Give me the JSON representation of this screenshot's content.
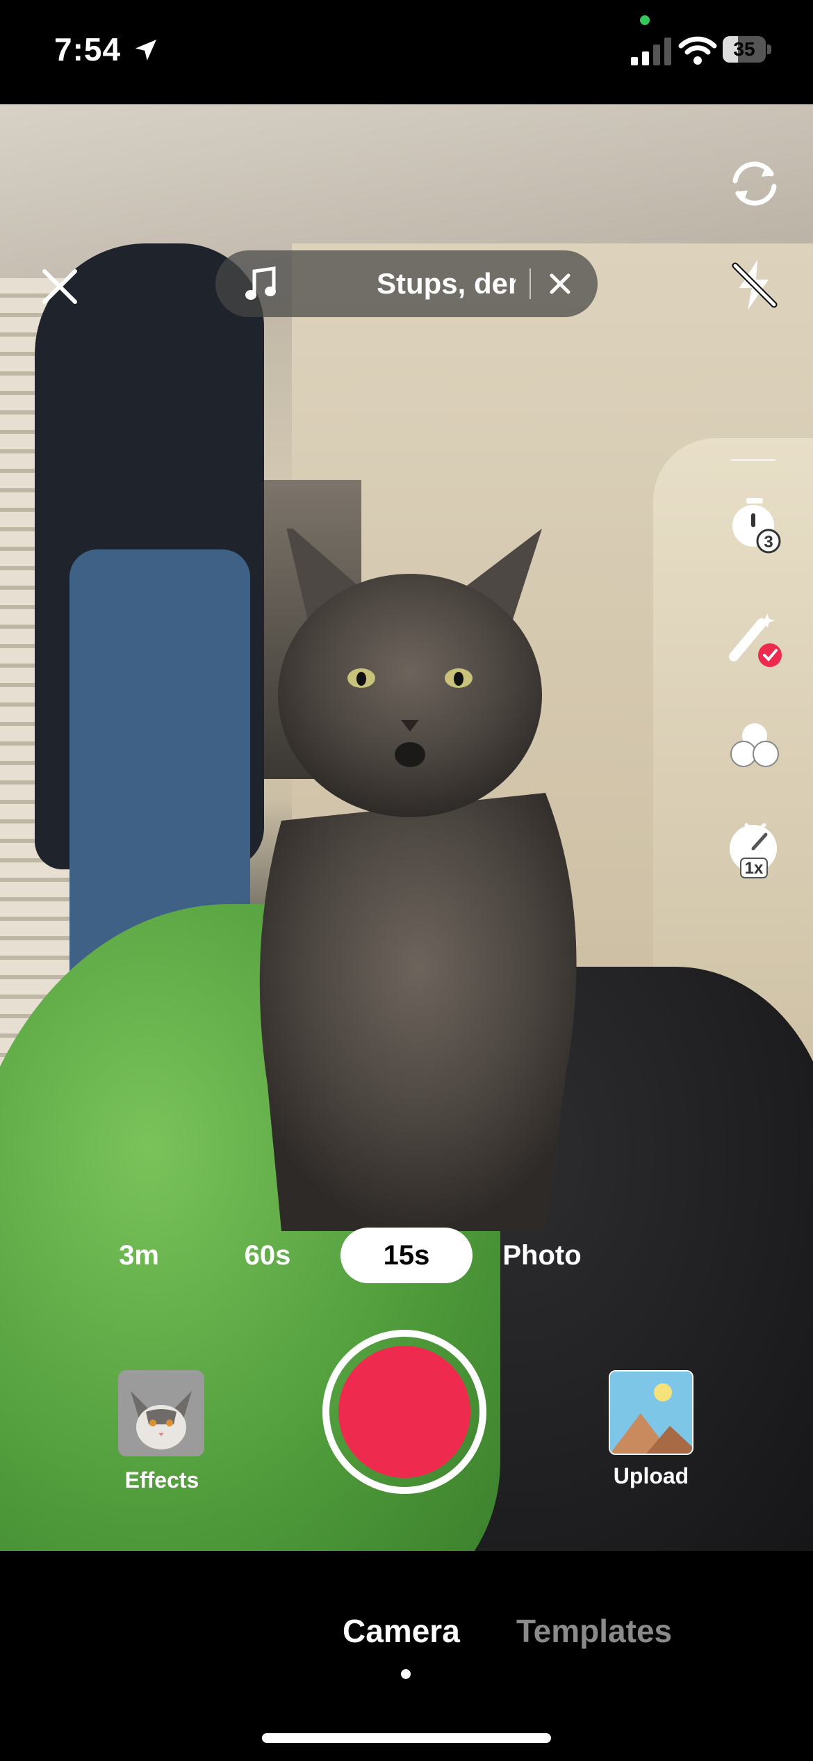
{
  "status_bar": {
    "time": "7:54",
    "battery_level": "35",
    "battery_fraction": 0.35,
    "icons": [
      "location-arrow-icon",
      "cellular-signal-icon",
      "wifi-icon",
      "battery-icon"
    ]
  },
  "music": {
    "title": "Stups, der",
    "icon": "music-note-icon",
    "clear_icon": "close-icon"
  },
  "side_toolbar": {
    "icons": [
      "flip-camera-icon",
      "flash-off-icon",
      "timer-3s-icon",
      "beauty-wand-icon",
      "filters-icon",
      "speed-1x-icon",
      "chevron-down-icon"
    ],
    "timer_badge": "3",
    "speed_badge": "1x"
  },
  "durations": {
    "options": [
      "3m",
      "60s",
      "15s",
      "Photo"
    ],
    "selected": "15s"
  },
  "effects": {
    "label": "Effects"
  },
  "upload": {
    "label": "Upload"
  },
  "bottom_tabs": {
    "camera": "Camera",
    "templates": "Templates",
    "active": "Camera"
  },
  "colors": {
    "record": "#ee2b4e",
    "inactive_tab": "#8a8a8a",
    "background": "#000000"
  }
}
